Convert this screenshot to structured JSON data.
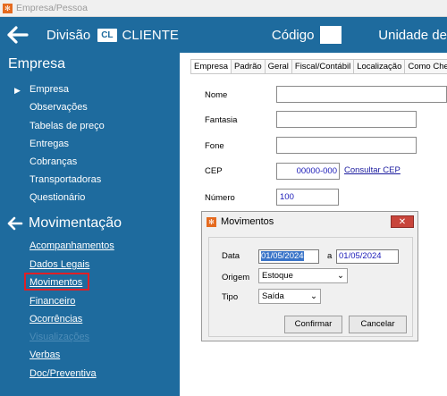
{
  "window": {
    "title": "Empresa/Pessoa"
  },
  "topbar": {
    "division_label": "Divisão",
    "division_code": "CL",
    "division_name": "CLIENTE",
    "code_label": "Código",
    "code_value": "",
    "unit_label": "Unidade de"
  },
  "sidebar": {
    "section_empresa": {
      "title": "Empresa",
      "items": [
        {
          "label": "Empresa"
        },
        {
          "label": "Observações"
        },
        {
          "label": "Tabelas de preço"
        },
        {
          "label": "Entregas"
        },
        {
          "label": "Cobranças"
        },
        {
          "label": "Transportadoras"
        },
        {
          "label": "Questionário"
        }
      ]
    },
    "section_movimentacao": {
      "title": "Movimentação",
      "items": [
        {
          "label": "Acompanhamentos"
        },
        {
          "label": "Dados Legais"
        },
        {
          "label": "Movimentos"
        },
        {
          "label": "Financeiro"
        },
        {
          "label": "Ocorrências"
        },
        {
          "label": "Visualizações"
        },
        {
          "label": "Verbas"
        },
        {
          "label": "Doc/Preventiva"
        }
      ]
    }
  },
  "tabs": [
    {
      "label": "Empresa"
    },
    {
      "label": "Padrão"
    },
    {
      "label": "Geral"
    },
    {
      "label": "Fiscal/Contábil"
    },
    {
      "label": "Localização"
    },
    {
      "label": "Como Che"
    }
  ],
  "form": {
    "nome_label": "Nome",
    "nome_value": "",
    "fantasia_label": "Fantasia",
    "fantasia_value": "",
    "fone_label": "Fone",
    "fone_value": "",
    "cep_label": "CEP",
    "cep_value": "00000-000",
    "cep_link": "Consultar CEP",
    "numero_label": "Número",
    "numero_value": "100"
  },
  "dialog": {
    "title": "Movimentos",
    "close_symbol": "✕",
    "data_label": "Data",
    "date_from": "01/05/2024",
    "date_sep": "a",
    "date_to": "01/05/2024",
    "origem_label": "Origem",
    "origem_value": "Estoque",
    "tipo_label": "Tipo",
    "tipo_value": "Saída",
    "confirm_label": "Confirmar",
    "cancel_label": "Cancelar"
  },
  "colors": {
    "brand_blue": "#1e6b9e",
    "highlight_red": "#e01f26",
    "app_icon_orange": "#e56a1f"
  }
}
